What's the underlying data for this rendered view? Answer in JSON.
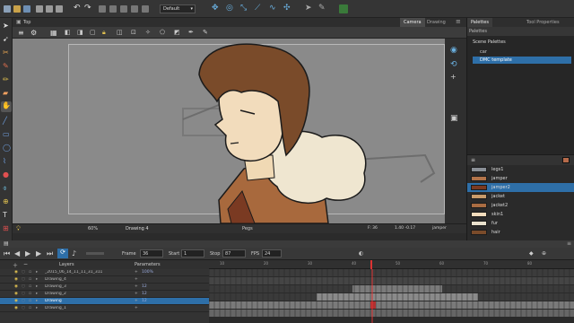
{
  "toolbar": {
    "preset": "Default"
  },
  "view": {
    "title": "Top",
    "tabs": [
      "Camera",
      "Drawing"
    ],
    "status": {
      "zoom": "60%",
      "drawing": "Drawing 4",
      "mode": "Pegs",
      "frame_readout": "F: 36",
      "coords": "1.40 -0.17",
      "palette": "jamper"
    }
  },
  "right_panel": {
    "tabs": [
      "Palettes",
      "Tool Properties"
    ],
    "palettes_header": "Palettes",
    "scene_palettes_label": "Scene Palettes",
    "palettes": [
      {
        "name": "car",
        "selected": false
      },
      {
        "name": "DMC template",
        "selected": true
      }
    ],
    "swatches": [
      {
        "name": "legs1",
        "color": "#8a8f96",
        "selected": false
      },
      {
        "name": "jamper",
        "color": "#b2744a",
        "selected": false
      },
      {
        "name": "jamper2",
        "color": "#7a3a22",
        "selected": true
      },
      {
        "name": "jacket",
        "color": "#c99b6a",
        "selected": false
      },
      {
        "name": "jacket2",
        "color": "#a96c42",
        "selected": false
      },
      {
        "name": "skin1",
        "color": "#f2dcbc",
        "selected": false
      },
      {
        "name": "fur",
        "color": "#e9e1cd",
        "selected": false
      },
      {
        "name": "hair",
        "color": "#7a4b2a",
        "selected": false
      }
    ]
  },
  "timeline": {
    "frame_label": "Frame",
    "frame_value": "36",
    "start_label": "Start",
    "start_value": "1",
    "stop_label": "Stop",
    "stop_value": "87",
    "fps_label": "FPS",
    "fps_value": "24",
    "layers_header": "Layers",
    "parameters_header": "Parameters",
    "ruler": [
      "10",
      "20",
      "30",
      "40",
      "50",
      "60",
      "70",
      "80"
    ],
    "layers": [
      {
        "name": "_2015_06_14_11_11_31_311",
        "param": "100%",
        "selected": false
      },
      {
        "name": "Drawing_4",
        "param": "",
        "selected": false
      },
      {
        "name": "Drawing_3",
        "param": "12",
        "selected": false
      },
      {
        "name": "Drawing_2",
        "param": "12",
        "selected": false
      },
      {
        "name": "Drawing",
        "param": "12",
        "selected": true
      },
      {
        "name": "Drawing_1",
        "param": "",
        "selected": false
      }
    ]
  },
  "colors": {
    "accent": "#2e6fa8",
    "stage": "#838383"
  }
}
